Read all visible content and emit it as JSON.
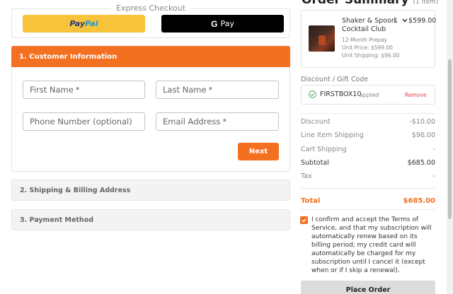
{
  "express": {
    "title": "Express Checkout",
    "paypal_pay": "Pay",
    "paypal_pal": "Pal",
    "gpay_g": "G",
    "gpay_label": "Pay"
  },
  "customer": {
    "header": "1. Customer Information",
    "first_name": "First Name",
    "last_name": "Last Name",
    "phone": "Phone Number (optional)",
    "email": "Email Address",
    "required_mark": "*",
    "next": "Next"
  },
  "sections": {
    "shipping": "2. Shipping & Billing Address",
    "payment": "3. Payment Method"
  },
  "summary": {
    "title": "Order Summary",
    "count": "(1 item)",
    "item": {
      "name": "Shaker & Spoon Cocktail Club",
      "qty": "1",
      "price": "$599.00",
      "plan": "12-Month Prepay",
      "unit_price": "Unit Price: $599.00",
      "unit_shipping": "Unit Shipping: $96.00"
    },
    "discount_label": "Discount / Gift Code",
    "coupon": {
      "code": "FIRSTBOX10",
      "status": "applied",
      "remove": "Remove"
    },
    "rows": [
      {
        "label": "Discount",
        "value": "-$10.00"
      },
      {
        "label": "Line Item Shipping",
        "value": "$96.00"
      },
      {
        "label": "Cart Shipping",
        "value": "-"
      },
      {
        "label": "Subtotal",
        "value": "$685.00"
      },
      {
        "label": "Tax",
        "value": "-"
      }
    ],
    "total_label": "Total",
    "total_value": "$685.00",
    "terms": "I confirm and accept the Terms of Service, and that my subscription will automatically renew based on its billing period; my credit card will automatically be charged for my subscription until I cancel it (except when or if I skip a renewal).",
    "place_order": "Place Order"
  },
  "colors": {
    "accent": "#f37021",
    "paypal_yellow": "#f6c33a",
    "remove_red": "#e0433a"
  }
}
